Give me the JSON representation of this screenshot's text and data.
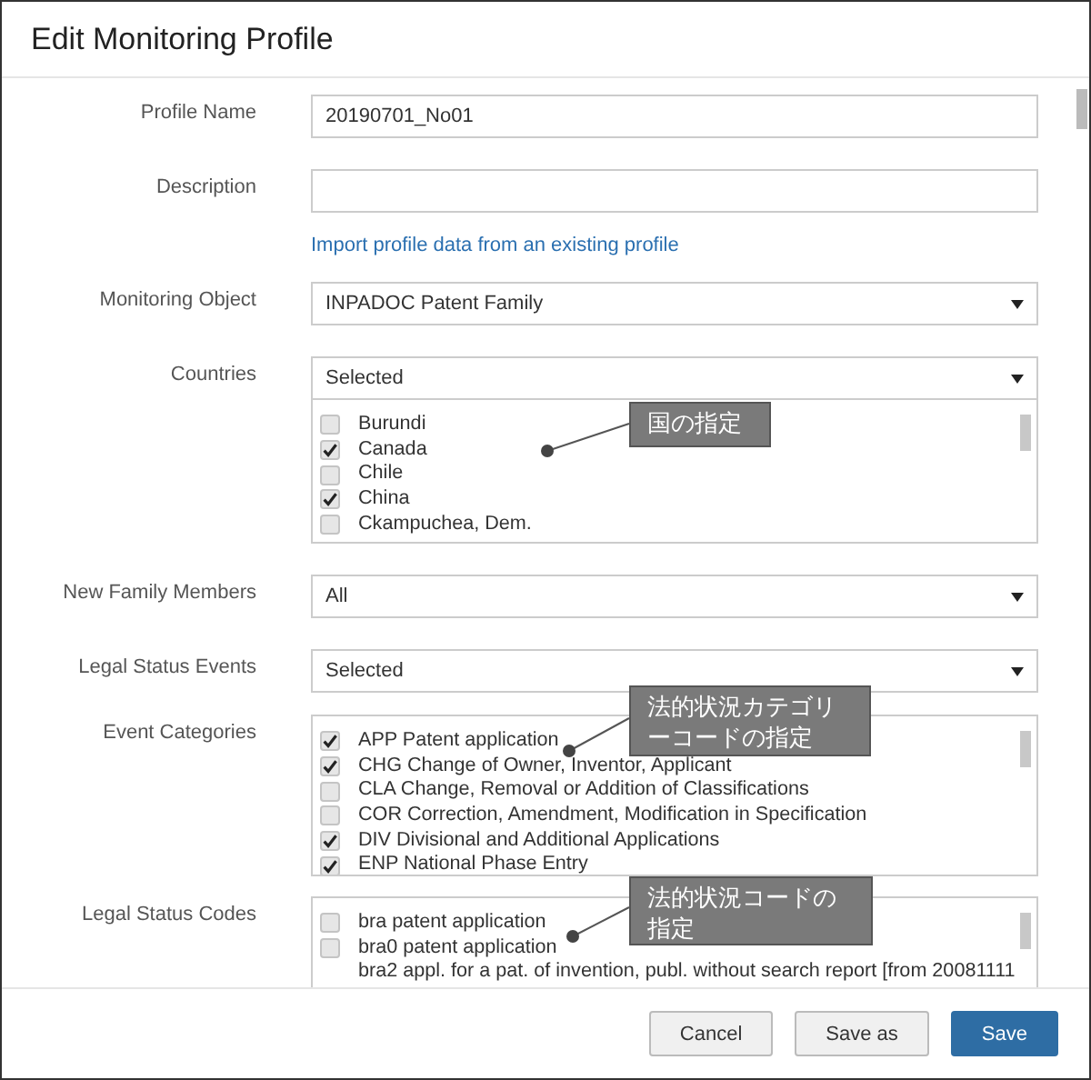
{
  "dialog": {
    "title": "Edit Monitoring Profile"
  },
  "form": {
    "profile_name": {
      "label": "Profile Name",
      "value": "20190701_No01"
    },
    "description": {
      "label": "Description"
    },
    "import_link": "Import profile data from an existing profile",
    "monitoring_object": {
      "label": "Monitoring Object",
      "value": "INPADOC Patent Family"
    },
    "countries": {
      "label": "Countries",
      "value": "Selected",
      "items": [
        {
          "label": "Burundi",
          "checked": false
        },
        {
          "label": "Canada",
          "checked": true
        },
        {
          "label": "Chile",
          "checked": false
        },
        {
          "label": "China",
          "checked": true
        },
        {
          "label": "Ckampuchea, Dem.",
          "checked": false
        }
      ]
    },
    "new_family_members": {
      "label": "New Family Members",
      "value": "All"
    },
    "legal_status_events": {
      "label": "Legal Status Events",
      "value": "Selected"
    },
    "event_categories": {
      "label": "Event Categories",
      "items": [
        {
          "label": "APP Patent application",
          "checked": true
        },
        {
          "label": "CHG Change of Owner, Inventor, Applicant",
          "checked": true
        },
        {
          "label": "CLA Change, Removal or Addition of Classifications",
          "checked": false
        },
        {
          "label": "COR Correction, Amendment, Modification in Specification",
          "checked": false
        },
        {
          "label": "DIV Divisional and Additional Applications",
          "checked": true
        },
        {
          "label": "ENP National Phase Entry",
          "checked": true
        }
      ]
    },
    "legal_status_codes": {
      "label": "Legal Status Codes",
      "items": [
        {
          "kind": "check",
          "label": "bra patent application",
          "checked": false
        },
        {
          "kind": "check",
          "label": "bra0 patent application",
          "checked": false
        },
        {
          "kind": "plain",
          "label": "bra2 appl. for a pat. of invention, publ. without search report [from 20081111"
        }
      ]
    }
  },
  "callouts": [
    "国の指定",
    "法的状況カテゴリーコードの指定",
    "法的状況コードの指定"
  ],
  "buttons": [
    {
      "label": "Cancel",
      "kind": "default"
    },
    {
      "label": "Save as",
      "kind": "default"
    },
    {
      "label": "Save",
      "kind": "primary"
    }
  ]
}
